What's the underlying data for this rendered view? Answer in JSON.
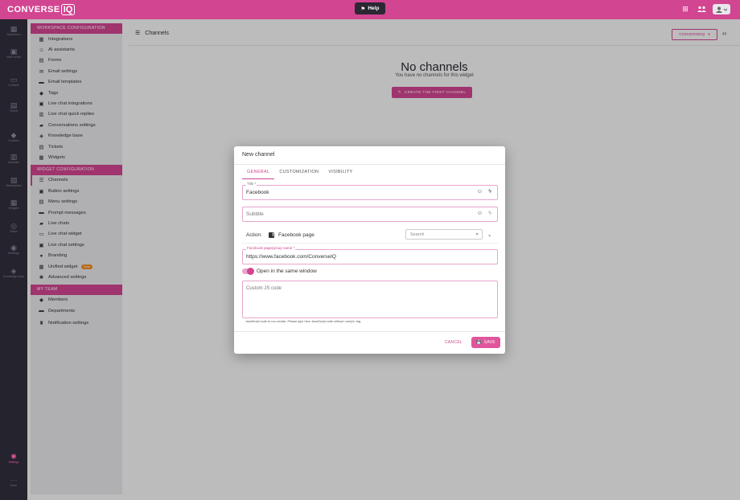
{
  "app": {
    "logo_text": "CONVERSE",
    "logo_suffix": "IQ",
    "help_label": "Help"
  },
  "rail": {
    "items": [
      {
        "label": "Dashboard",
        "icon": "grid-icon"
      },
      {
        "label": "Work mode",
        "icon": "layout-icon"
      },
      {
        "label": "Contacts",
        "icon": "chat-icon"
      },
      {
        "label": "Tickets",
        "icon": "ticket-icon"
      },
      {
        "label": "Contacts",
        "icon": "people-icon"
      },
      {
        "label": "Analytics",
        "icon": "chart-icon"
      },
      {
        "label": "Marketplace",
        "icon": "store-icon"
      },
      {
        "label": "Widgets",
        "icon": "widget-icon"
      },
      {
        "label": "Status",
        "icon": "check-icon"
      },
      {
        "label": "Meetings",
        "icon": "meeting-icon"
      },
      {
        "label": "Knowledge base",
        "icon": "book-icon"
      }
    ],
    "settings_label": "Settings",
    "more_label": "More"
  },
  "settings_menu": {
    "workspace_header": "WORKSPACE CONFIGURATION",
    "workspace_items": [
      {
        "label": "Integrations",
        "icon": "grid-icon"
      },
      {
        "label": "AI assistants",
        "icon": "user-icon"
      },
      {
        "label": "Forms",
        "icon": "form-icon"
      },
      {
        "label": "Email settings",
        "icon": "mail-icon"
      },
      {
        "label": "Email templates",
        "icon": "template-icon"
      },
      {
        "label": "Tags",
        "icon": "tag-icon"
      },
      {
        "label": "Live chat integrations",
        "icon": "chat-icon"
      },
      {
        "label": "Live chat quick replies",
        "icon": "reply-icon"
      },
      {
        "label": "Conversations settings",
        "icon": "conversation-icon"
      },
      {
        "label": "Knowledge base",
        "icon": "book-icon"
      },
      {
        "label": "Tickets",
        "icon": "ticket-icon"
      },
      {
        "label": "Widgets",
        "icon": "widget-icon"
      }
    ],
    "widget_header": "WIDGET CONFIGURATION",
    "widget_items": [
      {
        "label": "Channels",
        "icon": "list-icon",
        "active": true
      },
      {
        "label": "Button settings",
        "icon": "button-icon"
      },
      {
        "label": "Menu settings",
        "icon": "menu-icon"
      },
      {
        "label": "Prompt messages",
        "icon": "prompt-icon"
      },
      {
        "label": "Live chats",
        "icon": "chat-icon"
      },
      {
        "label": "Live chat widget",
        "icon": "chat-widget-icon"
      },
      {
        "label": "Live chat settings",
        "icon": "chat-settings-icon"
      },
      {
        "label": "Branding",
        "icon": "branding-icon"
      },
      {
        "label": "Unified widget",
        "icon": "unified-icon",
        "badge": "beta"
      },
      {
        "label": "Advanced settings",
        "icon": "gear-icon"
      }
    ],
    "team_header": "MY TEAM",
    "team_items": [
      {
        "label": "Members",
        "icon": "people-icon"
      },
      {
        "label": "Departments",
        "icon": "department-icon"
      },
      {
        "label": "Notification settings",
        "icon": "bell-icon"
      }
    ]
  },
  "main": {
    "title": "Channels",
    "widget_select": "CONVERSEIQ",
    "empty_title": "No channels",
    "empty_subtitle": "You have no channels for this widget",
    "create_button": "CREATE THE FIRST CHANNEL"
  },
  "modal": {
    "title": "New channel",
    "tabs": [
      "GENERAL",
      "CUSTOMIZATION",
      "VISIBILITY"
    ],
    "active_tab": "GENERAL",
    "title_field": {
      "label": "Title *",
      "value": "Facebook"
    },
    "subtitle_field": {
      "placeholder": "Subtitle"
    },
    "action": {
      "label": "Action:",
      "value": "Facebook page",
      "search_placeholder": "Search"
    },
    "fb_field": {
      "label": "Facebook page/group name *",
      "value": "https://www.facebook.com/ConverseIQ"
    },
    "toggle": {
      "label": "Open in the same window",
      "on": true
    },
    "js_field": {
      "placeholder": "Custom JS code",
      "hint": "JavaScript code to run onclick. Please type here JavaScript code without <script> tag."
    },
    "cancel_label": "CANCEL",
    "save_label": "SAVE"
  },
  "colors": {
    "brand": "#d24591",
    "sidebar_dark": "#25232d",
    "beta_badge": "#f08c1f"
  }
}
